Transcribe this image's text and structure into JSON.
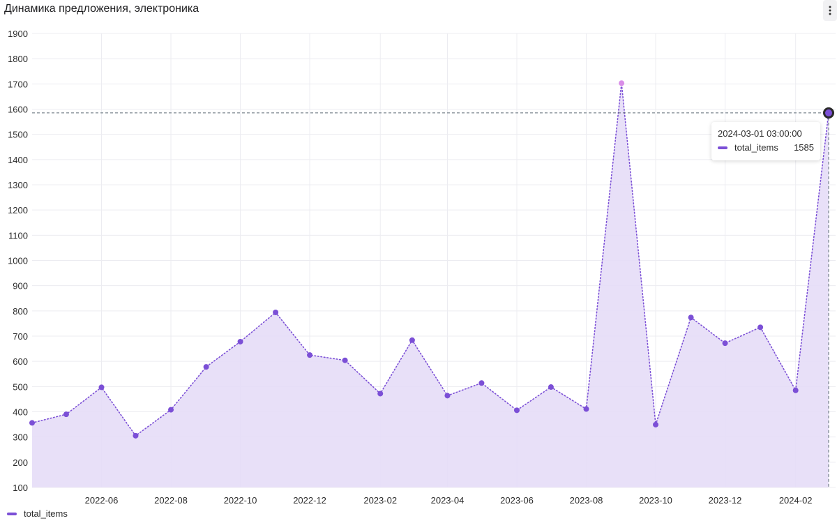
{
  "panel": {
    "title": "Динамика предложения, электроника"
  },
  "icons": {
    "menu": "vertical-ellipsis-icon"
  },
  "tooltip": {
    "time": "2024-03-01 03:00:00",
    "series_name": "total_items",
    "value": "1585"
  },
  "legend": {
    "label": "total_items"
  },
  "colors": {
    "line": "#7b4fd6",
    "area": "#e6ddf7",
    "point": "#7b4fd6",
    "highlight_point": "#d98ee8",
    "crosshair": "#5d6b75",
    "grid": "#ececf1"
  },
  "chart_data": {
    "type": "area",
    "title": "Динамика предложения, электроника",
    "series": [
      {
        "name": "total_items",
        "x": [
          "2022-04-01",
          "2022-05-01",
          "2022-06-01",
          "2022-07-01",
          "2022-08-01",
          "2022-09-01",
          "2022-10-01",
          "2022-11-01",
          "2022-12-01",
          "2023-01-01",
          "2023-02-01",
          "2023-03-01",
          "2023-04-01",
          "2023-05-01",
          "2023-06-01",
          "2023-07-01",
          "2023-08-01",
          "2023-09-01",
          "2023-10-01",
          "2023-11-01",
          "2023-12-01",
          "2024-01-01",
          "2024-02-01",
          "2024-03-01"
        ],
        "values": [
          356,
          390,
          497,
          305,
          408,
          578,
          678,
          794,
          625,
          604,
          472,
          684,
          464,
          514,
          406,
          498,
          411,
          1703,
          349,
          774,
          672,
          735,
          485,
          1585
        ]
      }
    ],
    "highlighted_index": 17,
    "hovered_index": 23,
    "x_ticks": [
      "2022-06",
      "2022-08",
      "2022-10",
      "2022-12",
      "2023-02",
      "2023-04",
      "2023-06",
      "2023-08",
      "2023-10",
      "2023-12",
      "2024-02"
    ],
    "y_ticks": [
      100,
      200,
      300,
      400,
      500,
      600,
      700,
      800,
      900,
      1000,
      1100,
      1200,
      1300,
      1400,
      1500,
      1600,
      1700,
      1800,
      1900
    ],
    "ylim": [
      100,
      1900
    ],
    "xlim": [
      "2022-04-01",
      "2024-03-01"
    ],
    "grid": true,
    "legend_position": "bottom-left"
  }
}
